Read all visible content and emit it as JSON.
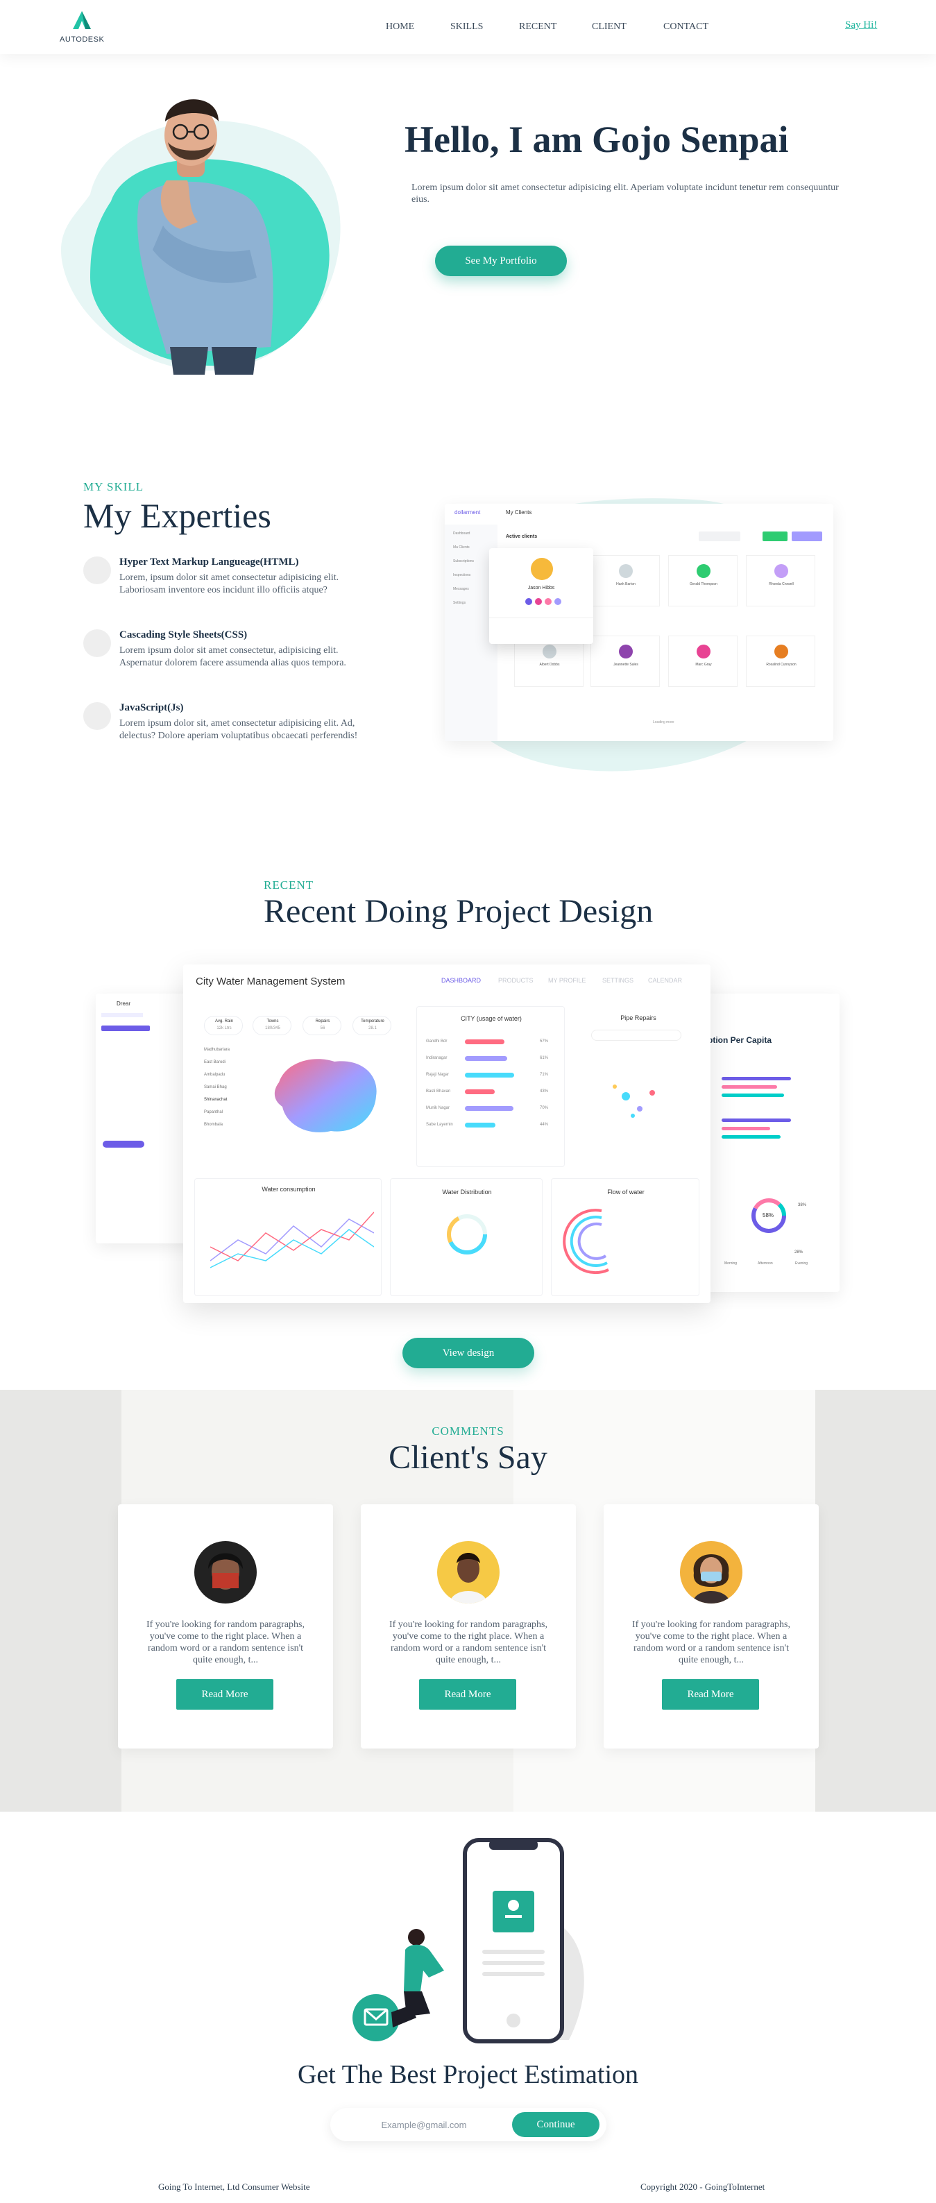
{
  "nav": {
    "brand": "AUTODESK",
    "links": [
      "HOME",
      "SKILLS",
      "RECENT",
      "CLIENT",
      "CONTACT"
    ],
    "cta": "Say Hi!"
  },
  "hero": {
    "title": "Hello, I am Gojo Senpai",
    "description": "Lorem ipsum dolor sit amet consectetur adipisicing elit. Aperiam voluptate incidunt tenetur rem consequuntur eius.",
    "button": "See My Portfolio"
  },
  "skills": {
    "kicker": "MY SKILL",
    "title": "My Experties",
    "items": [
      {
        "name": "Hyper Text Markup Langueage(HTML)",
        "desc": "Lorem, ipsum dolor sit amet consectetur adipisicing elit. Laboriosam inventore eos incidunt illo officiis atque?"
      },
      {
        "name": "Cascading Style Sheets(CSS)",
        "desc": "Lorem ipsum dolor sit amet consectetur, adipisicing elit. Aspernatur dolorem facere assumenda alias quos tempora."
      },
      {
        "name": "JavaScript(Js)",
        "desc": "Lorem ipsum dolor sit, amet consectetur adipisicing elit. Ad, delectus? Dolore aperiam voluptatibus obcaecati perferendis!"
      }
    ],
    "mockup": {
      "brand": "dollarment",
      "header": "My Clients",
      "tab": "Active clients",
      "sidebar": [
        "Dashboard",
        "Ma Clients",
        "Subscriptions",
        "Inspections",
        "Messages",
        "Settings"
      ],
      "clients": [
        "Jason Hibbs",
        "Hank Barton",
        "Gerald Thompson",
        "Rhonda Crowell",
        "Albert Dobbs",
        "Jeannette Sales",
        "Marc Gray",
        "Rosalind Cunnyson"
      ],
      "load_more": "Loading more"
    }
  },
  "recent": {
    "kicker": "RECENT",
    "title": "Recent Doing Project Design",
    "button": "View design",
    "dashboard": {
      "title": "City Water Management System",
      "tabs": [
        "DASHBOARD",
        "PRODUCTS",
        "MY PROFILE",
        "SETTINGS",
        "CALENDAR"
      ],
      "stats": [
        "Avg. Rain",
        "Towns",
        "Repairs",
        "Temperature"
      ],
      "stat_values": [
        "12k Ltrs",
        "180/345",
        "56",
        "28.1"
      ],
      "districts": [
        "Madhubarlara",
        "East Barodi",
        "Ambalpadu",
        "Samai Bhag",
        "Shinanachat",
        "Papanthal",
        "Bhombala"
      ],
      "usage_title": "CITY (usage of water)",
      "usage_labels": [
        "Gandhi Bdr",
        "Indiranagar",
        "Rajaji Nagar",
        "Basti Bhavan",
        "Munik Nagar",
        "Sabe Layernin"
      ],
      "usage_pcts": [
        "57%",
        "61%",
        "71%",
        "43%",
        "70%",
        "44%"
      ],
      "repairs_title": "Pipe Repairs",
      "consumption_title": "Water consumption",
      "distribution_title": "Water Distribution",
      "flow_title": "Flow of water",
      "side_title": "ption Per Capita",
      "side_brand": "Drear",
      "donut_pct": "58%",
      "donut_labels": [
        "38%",
        "28%"
      ],
      "side_legend": [
        "Morning",
        "Afternoon",
        "Evening"
      ]
    }
  },
  "clients": {
    "kicker": "COMMENTS",
    "title": "Client's Say",
    "cards": [
      {
        "quote": "If you're looking for random paragraphs, you've come to the right place. When a random word or a random sentence isn't quite enough, t...",
        "button": "Read More"
      },
      {
        "quote": "If you're looking for random paragraphs, you've come to the right place. When a random word or a random sentence isn't quite enough, t...",
        "button": "Read More"
      },
      {
        "quote": "If you're looking for random paragraphs, you've come to the right place. When a random word or a random sentence isn't quite enough, t...",
        "button": "Read More"
      }
    ]
  },
  "estimation": {
    "title": "Get The Best Project Estimation",
    "email_placeholder": "Example@gmail.com",
    "button": "Continue"
  },
  "footer": {
    "left": "Going To Internet, Ltd Consumer Website",
    "right": "Copyright 2020 - GoingToInternet"
  },
  "colors": {
    "accent": "#22ac93",
    "teal_light": "#44dcc3",
    "navy": "#1c3045"
  }
}
